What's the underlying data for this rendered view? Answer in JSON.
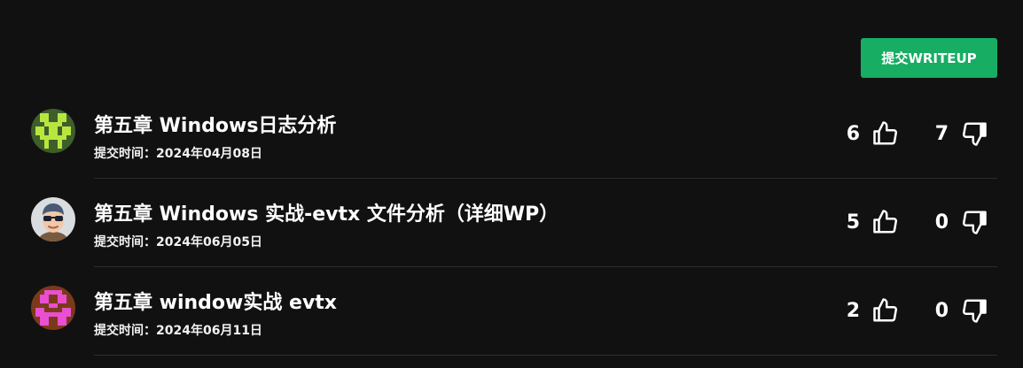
{
  "submit_button_label": "提交WRITEUP",
  "colors": {
    "background": "#121112",
    "accent": "#17ad63",
    "divider": "#2c2b2d"
  },
  "writeups": [
    {
      "title": "第五章 Windows日志分析",
      "date": "提交时间：2024年04月08日",
      "likes": "6",
      "dislikes": "7",
      "avatar": "green-pixel-avatar"
    },
    {
      "title": "第五章 Windows 实战-evtx 文件分析（详细WP）",
      "date": "提交时间：2024年06月05日",
      "likes": "5",
      "dislikes": "0",
      "avatar": "cartoon-sunglasses-avatar"
    },
    {
      "title": "第五章 window实战 evtx",
      "date": "提交时间：2024年06月11日",
      "likes": "2",
      "dislikes": "0",
      "avatar": "pink-pixel-avatar"
    }
  ]
}
